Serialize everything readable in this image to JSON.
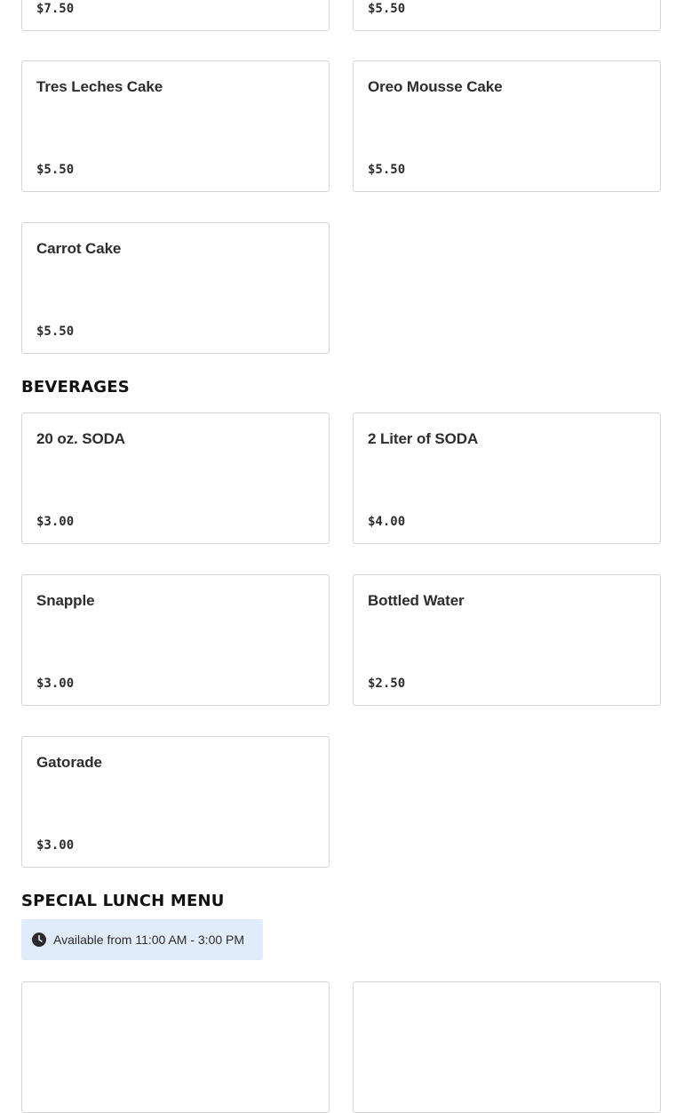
{
  "dessert_cards": [
    {
      "name": "",
      "price": "$7.50"
    },
    {
      "name": "",
      "price": "$5.50"
    },
    {
      "name": "Tres Leches Cake",
      "price": "$5.50"
    },
    {
      "name": "Oreo Mousse Cake",
      "price": "$5.50"
    },
    {
      "name": "Carrot Cake",
      "price": "$5.50"
    }
  ],
  "beverages": {
    "title": "BEVERAGES",
    "items": [
      {
        "name": "20 oz. SODA",
        "price": "$3.00"
      },
      {
        "name": "2 Liter of SODA",
        "price": "$4.00"
      },
      {
        "name": "Snapple",
        "price": "$3.00"
      },
      {
        "name": "Bottled Water",
        "price": "$2.50"
      },
      {
        "name": "Gatorade",
        "price": "$3.00"
      }
    ]
  },
  "special_lunch": {
    "title": "SPECIAL LUNCH MENU",
    "availability": "Available from 11:00 AM - 3:00 PM",
    "icon": "clock-icon"
  }
}
